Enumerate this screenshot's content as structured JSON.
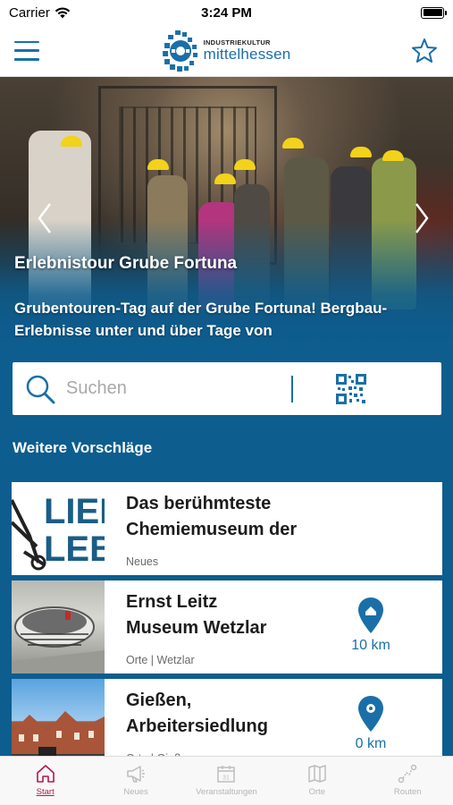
{
  "status_bar": {
    "carrier": "Carrier",
    "time": "3:24 PM"
  },
  "header": {
    "logo_small": "INDUSTRIEKULTUR",
    "logo_big": "mittelhessen",
    "accent_color": "#1a6fa8"
  },
  "hero": {
    "title": "Erlebnistour Grube Fortuna",
    "text": "Grubentouren-Tag auf der Grube Fortuna! Bergbau-Erlebnisse unter und über Tage von"
  },
  "search": {
    "placeholder": "Suchen"
  },
  "suggestions": {
    "title": "Weitere Vorschläge",
    "items": [
      {
        "title_line1": "Das berühmteste",
        "title_line2": "Chemiemuseum der",
        "meta": "Neues",
        "thumb_text_1": "LIEB",
        "thumb_text_2": "LEB"
      },
      {
        "title_line1": "Ernst Leitz",
        "title_line2": "Museum Wetzlar",
        "meta": "Orte | Wetzlar",
        "distance": "10 km"
      },
      {
        "title_line1": "Gießen,",
        "title_line2": "Arbeitersiedlung",
        "meta": "Orte | Gießen",
        "distance": "0 km"
      }
    ]
  },
  "tabs": [
    {
      "label": "Start",
      "icon": "home-icon",
      "active": true
    },
    {
      "label": "Neues",
      "icon": "megaphone-icon",
      "active": false
    },
    {
      "label": "Veranstaltungen",
      "icon": "calendar-icon",
      "active": false
    },
    {
      "label": "Orte",
      "icon": "map-icon",
      "active": false
    },
    {
      "label": "Routen",
      "icon": "route-icon",
      "active": false
    }
  ],
  "colors": {
    "brand_blue": "#0d5d8f",
    "active_tab": "#b31a4a"
  }
}
